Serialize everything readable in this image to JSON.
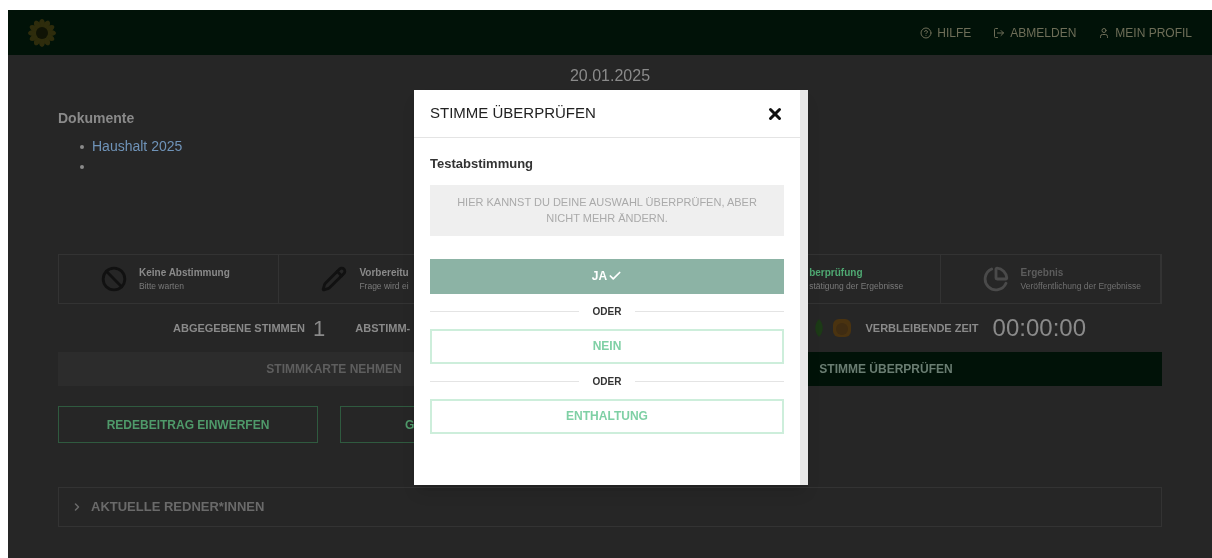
{
  "header": {
    "nav": [
      {
        "label": "HILFE",
        "kind": "help"
      },
      {
        "label": "ABMELDEN",
        "kind": "logout"
      },
      {
        "label": "MEIN PROFIL",
        "kind": "profile"
      }
    ]
  },
  "date": "20.01.2025",
  "documents": {
    "heading": "Dokumente",
    "items": [
      {
        "kind": "link",
        "title": "Haushalt 2025"
      },
      {
        "kind": "empty"
      }
    ]
  },
  "steps": [
    {
      "title": "Keine Abstimmung",
      "subtitle": "Bitte warten",
      "kind": "waiting",
      "active": false,
      "disabled": false
    },
    {
      "title": "Vorbereitu",
      "subtitle": "Frage wird ei",
      "kind": "preparation",
      "active": false,
      "disabled": false
    },
    {
      "title": "berprüfung",
      "subtitle": "stätigung der Ergebnisse",
      "kind": "review",
      "active": true,
      "disabled": false
    },
    {
      "title": "Ergebnis",
      "subtitle": "Veröffentlichung der Ergebnisse",
      "kind": "result",
      "active": false,
      "disabled": true
    }
  ],
  "stats": {
    "cast_label": "ABGEGEBENE STIMMEN",
    "cast_value": "1",
    "mode_label": "ABSTIMM-",
    "remaining_label": "VERBLEIBENDE ZEIT",
    "remaining_value": "00:00:00"
  },
  "actions": [
    {
      "label": "STIMMKARTE NEHMEN",
      "disabled": true
    },
    {
      "label": "STIMME ÜBERPRÜFEN",
      "disabled": false
    }
  ],
  "secondary_actions": [
    "REDEBEITRAG EINWERFEN",
    "G"
  ],
  "speakers_panel": {
    "title": "AKTUELLE REDNER*INNEN"
  },
  "modal": {
    "title": "STIMME ÜBERPRÜFEN",
    "subject": "Testabstimmung",
    "notice": "HIER KANNST DU DEINE AUSWAHL ÜBERPRÜFEN, ABER NICHT MEHR ÄNDERN.",
    "options": [
      {
        "label": "JA",
        "selected": true
      },
      {
        "label": "NEIN",
        "selected": false
      },
      {
        "label": "ENTHALTUNG",
        "selected": false
      }
    ],
    "separators": [
      "ODER",
      "ODER"
    ]
  }
}
